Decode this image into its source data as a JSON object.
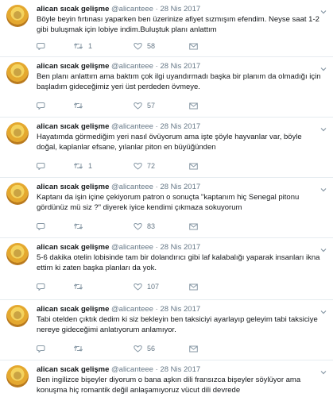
{
  "user": {
    "name": "alican sıcak gelişme",
    "handle": "@alicanteee",
    "separator": "·"
  },
  "tweets": [
    {
      "date": "28 Nis 2017",
      "text": "Böyle beyin fırtınası yaparken ben üzerinize afiyet sızmışım efendim. Neyse saat 1-2 gibi buluşmak için lobiye indim.Buluştuk planı anlattım",
      "retweets": "1",
      "likes": "58"
    },
    {
      "date": "28 Nis 2017",
      "text": "Ben planı anlattım ama baktım çok ilgi uyandırmadı başka bir planım da olmadığı için başladım gideceğimiz yeri üst perdeden övmeye.",
      "retweets": "",
      "likes": "57"
    },
    {
      "date": "28 Nis 2017",
      "text": "Hayatımda görmediğim yeri nasıl övüyorum ama işte şöyle hayvanlar var, böyle doğal, kaplanlar efsane, yılanlar piton en büyüğünden",
      "retweets": "1",
      "likes": "72"
    },
    {
      "date": "28 Nis 2017",
      "text": "Kaptanı da işin içine çekiyorum patron o sonuçta \"kaptanım hiç Senegal pitonu gördünüz mü siz ?\" diyerek iyice kendimi çıkmaza sokuyorum",
      "retweets": "",
      "likes": "83"
    },
    {
      "date": "28 Nis 2017",
      "text": "5-6 dakika otelin lobisinde tam bir dolandırıcı gibi laf kalabalığı yaparak insanları ikna ettim ki zaten başka planları da yok.",
      "retweets": "",
      "likes": "107"
    },
    {
      "date": "28 Nis 2017",
      "text": "Tabi otelden çıktık dedim ki siz bekleyin ben taksiciyi ayarlayıp geleyim tabi taksiciye nereye gideceğimi anlatıyorum anlamıyor.",
      "retweets": "",
      "likes": "56"
    },
    {
      "date": "28 Nis 2017",
      "text": "Ben ingilizce bişeyler diyorum o bana aşkın dili fransızca bişeyler söylüyor ama konuşma hiç romantik değil anlaşamıyoruz vücut dili devrede",
      "retweets": "",
      "likes": ""
    }
  ],
  "colors": {
    "icon": "#8899a6",
    "meta": "#657786",
    "divider": "#e6ecf0"
  }
}
